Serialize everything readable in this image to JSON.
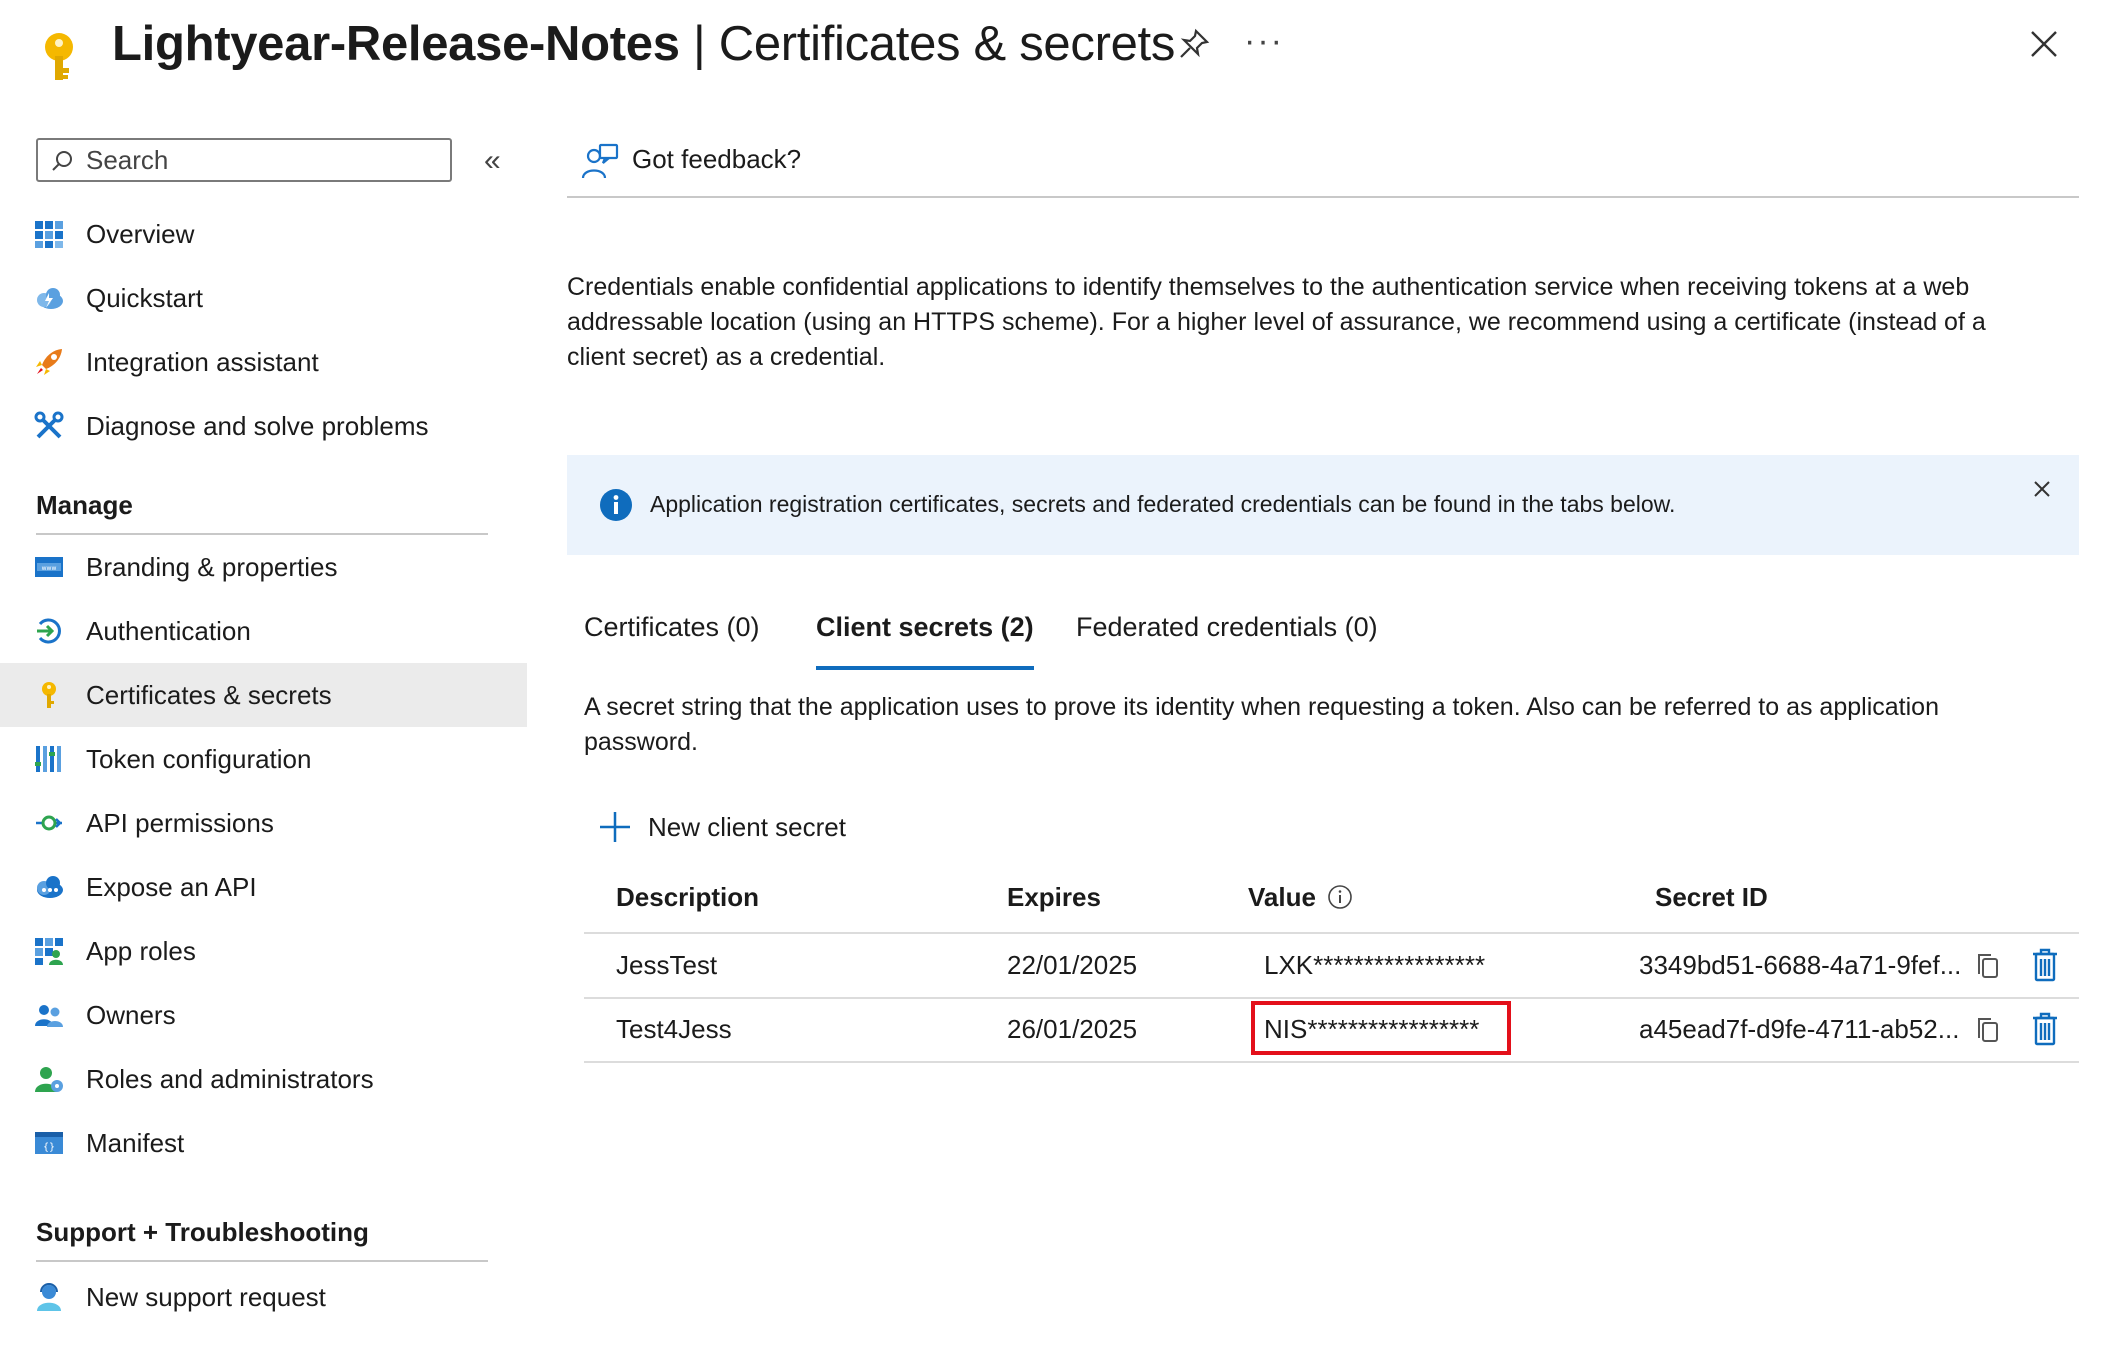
{
  "header": {
    "app_name": "Lightyear-Release-Notes",
    "separator": " | ",
    "page_name": "Certificates & secrets",
    "more_label": "···"
  },
  "sidebar": {
    "search_placeholder": "Search",
    "collapse_label": "«",
    "top_items": [
      {
        "label": "Overview",
        "icon": "overview-grid-icon"
      },
      {
        "label": "Quickstart",
        "icon": "cloud-lightning-icon"
      },
      {
        "label": "Integration assistant",
        "icon": "rocket-icon"
      },
      {
        "label": "Diagnose and solve problems",
        "icon": "wrench-icon"
      }
    ],
    "manage_heading": "Manage",
    "manage_items": [
      {
        "label": "Branding & properties",
        "icon": "branding-icon"
      },
      {
        "label": "Authentication",
        "icon": "authentication-icon"
      },
      {
        "label": "Certificates & secrets",
        "icon": "key-icon",
        "active": true
      },
      {
        "label": "Token configuration",
        "icon": "token-bars-icon"
      },
      {
        "label": "API permissions",
        "icon": "api-permissions-icon"
      },
      {
        "label": "Expose an API",
        "icon": "cloud-api-icon"
      },
      {
        "label": "App roles",
        "icon": "app-roles-grid-icon"
      },
      {
        "label": "Owners",
        "icon": "owners-people-icon"
      },
      {
        "label": "Roles and administrators",
        "icon": "roles-admin-icon"
      },
      {
        "label": "Manifest",
        "icon": "manifest-icon"
      }
    ],
    "support_heading": "Support + Troubleshooting",
    "support_items": [
      {
        "label": "New support request",
        "icon": "support-person-icon"
      }
    ]
  },
  "main": {
    "feedback_label": "Got feedback?",
    "description": "Credentials enable confidential applications to identify themselves to the authentication service when receiving tokens at a web addressable location (using an HTTPS scheme). For a higher level of assurance, we recommend using a certificate (instead of a client secret) as a credential.",
    "banner_text": "Application registration certificates, secrets and federated credentials can be found in the tabs below.",
    "tabs": [
      {
        "label": "Certificates (0)"
      },
      {
        "label": "Client secrets (2)",
        "active": true
      },
      {
        "label": "Federated credentials (0)"
      }
    ],
    "secrets_description": "A secret string that the application uses to prove its identity when requesting a token. Also can be referred to as application password.",
    "new_secret_label": "New client secret",
    "table": {
      "headers": [
        "Description",
        "Expires",
        "Value",
        "Secret ID"
      ],
      "rows": [
        {
          "description": "JessTest",
          "expires": "22/01/2025",
          "value": "LXK*****************",
          "secret_id": "3349bd51-6688-4a71-9fef..."
        },
        {
          "description": "Test4Jess",
          "expires": "26/01/2025",
          "value": "NIS*****************",
          "secret_id": "a45ead7f-d9fe-4711-ab52...",
          "highlighted": true
        }
      ]
    }
  },
  "colors": {
    "accent": "#0f6cbd",
    "highlight_border": "#e3101a",
    "banner_bg": "#ebf3fc",
    "active_nav_bg": "#ebebeb",
    "key_gold": "#f5b800"
  }
}
